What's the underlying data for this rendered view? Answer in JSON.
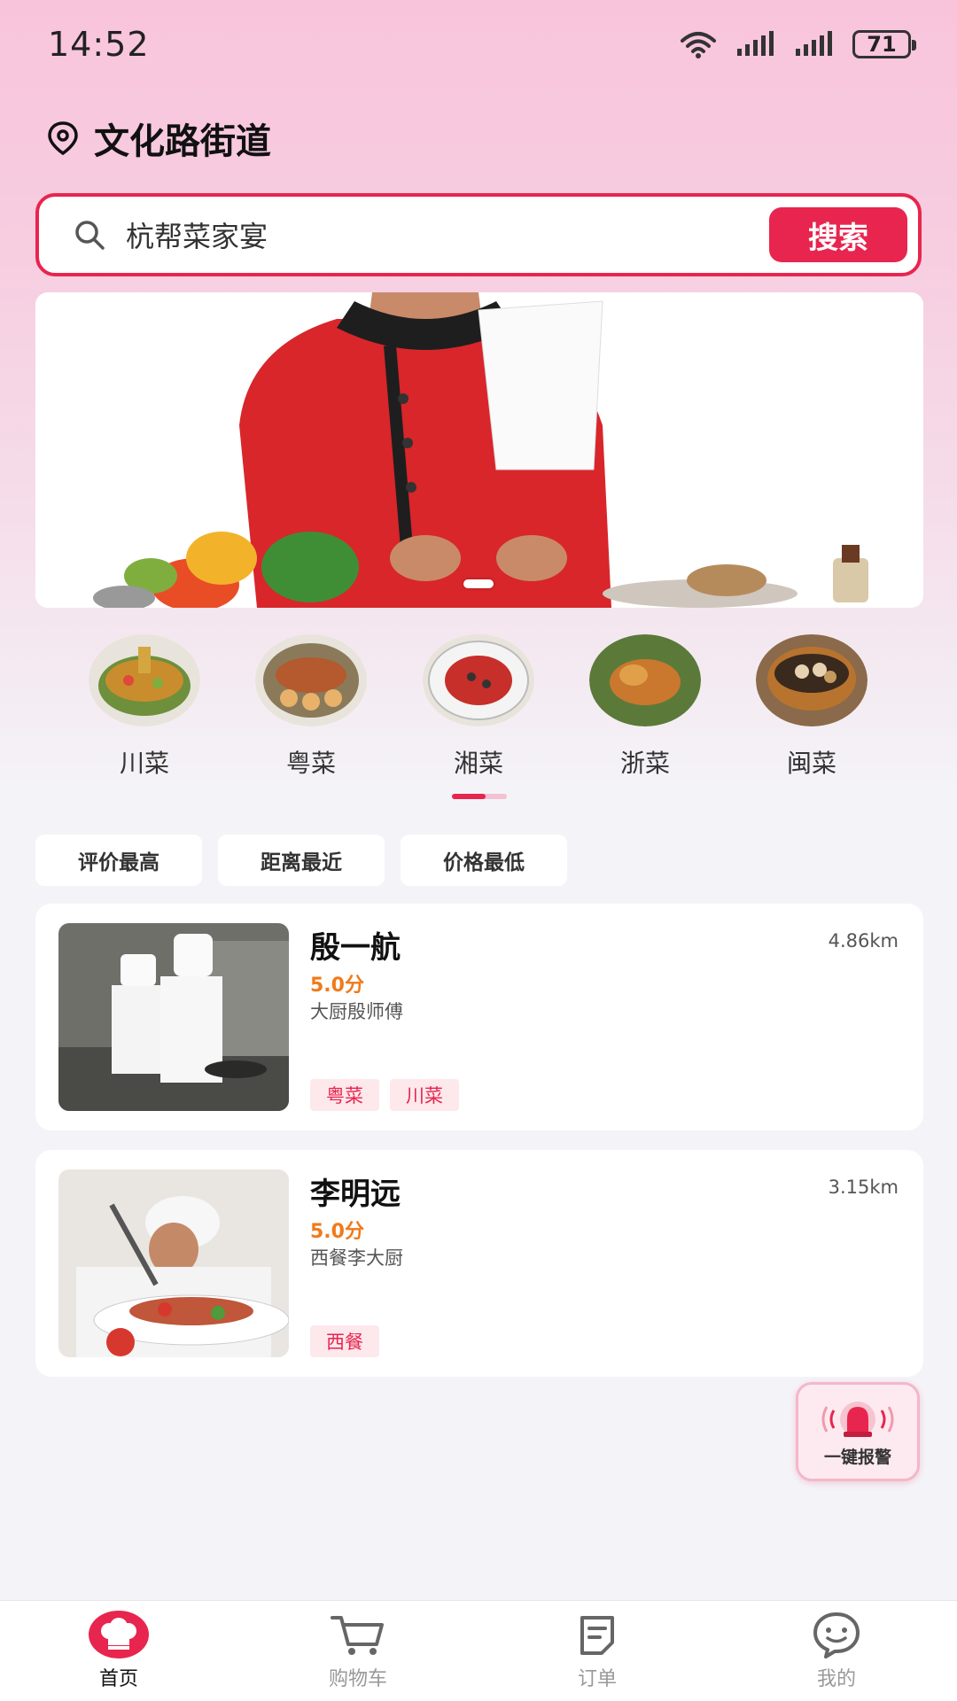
{
  "status_bar": {
    "time": "14:52",
    "battery": "71"
  },
  "location": {
    "name": "文化路街道"
  },
  "search": {
    "value": "杭帮菜家宴",
    "button_label": "搜索"
  },
  "categories": [
    {
      "label": "川菜"
    },
    {
      "label": "粤菜"
    },
    {
      "label": "湘菜"
    },
    {
      "label": "浙菜"
    },
    {
      "label": "闽菜"
    }
  ],
  "sort_options": [
    {
      "label": "评价最高"
    },
    {
      "label": "距离最近"
    },
    {
      "label": "价格最低"
    }
  ],
  "chefs": [
    {
      "name": "殷一航",
      "score": "5.0分",
      "description": "大厨殷师傅",
      "distance": "4.86km",
      "tags": [
        "粤菜",
        "川菜"
      ]
    },
    {
      "name": "李明远",
      "score": "5.0分",
      "description": "西餐李大厨",
      "distance": "3.15km",
      "tags": [
        "西餐"
      ]
    }
  ],
  "alarm": {
    "label": "一键报警"
  },
  "tabbar": [
    {
      "label": "首页",
      "icon": "chef-hat-icon",
      "active": true
    },
    {
      "label": "购物车",
      "icon": "cart-icon"
    },
    {
      "label": "订单",
      "icon": "order-icon"
    },
    {
      "label": "我的",
      "icon": "chat-face-icon"
    }
  ],
  "colors": {
    "accent": "#e8254e",
    "score": "#f07a1a"
  }
}
